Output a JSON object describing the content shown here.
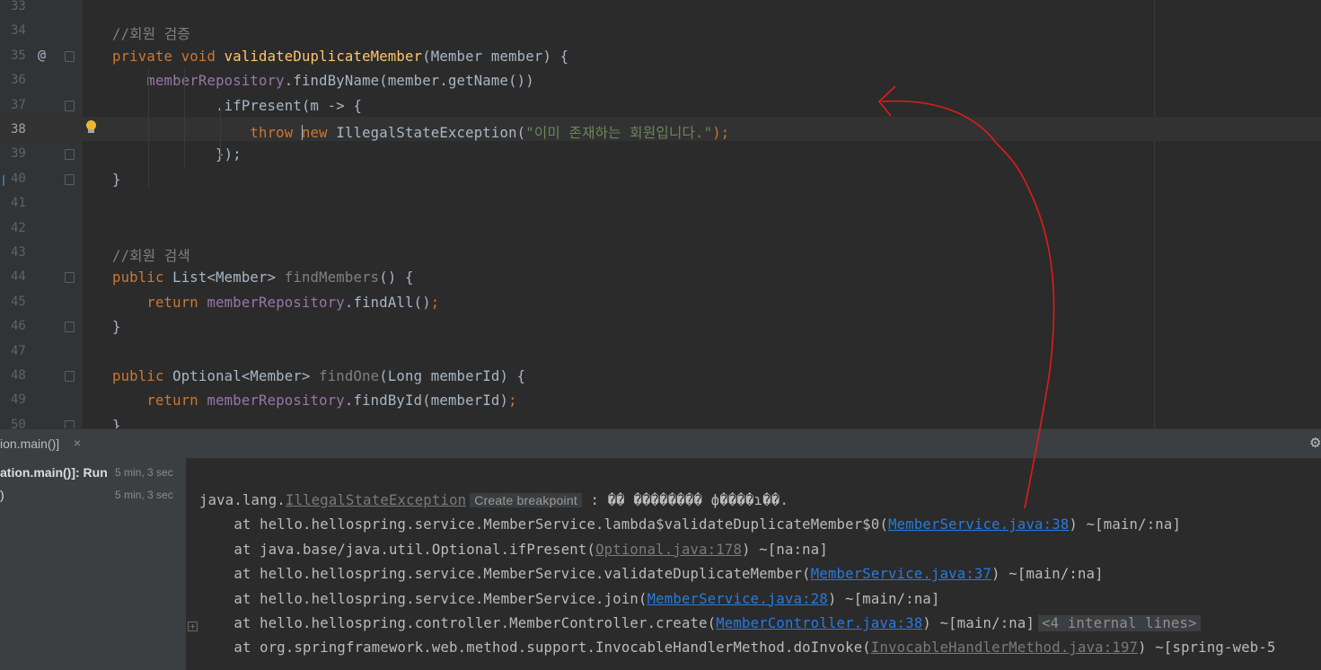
{
  "editor": {
    "lines": [
      {
        "num": "33",
        "tokens": []
      },
      {
        "num": "34",
        "tokens": [
          {
            "t": "//회원 검증",
            "c": "cm"
          }
        ]
      },
      {
        "num": "35",
        "tokens": [
          {
            "t": "private ",
            "c": "kw"
          },
          {
            "t": "void ",
            "c": "kw"
          },
          {
            "t": "validateDuplicateMember",
            "c": "fn"
          },
          {
            "t": "(Member member) {",
            "c": ""
          }
        ]
      },
      {
        "num": "36",
        "tokens": [
          {
            "t": "    ",
            "c": ""
          },
          {
            "t": "memberRepository",
            "c": "fld"
          },
          {
            "t": ".findByName(member.getName())",
            "c": ""
          }
        ]
      },
      {
        "num": "37",
        "tokens": [
          {
            "t": "            .ifPresent(m -> {",
            "c": ""
          }
        ]
      },
      {
        "num": "38",
        "tokens": [
          {
            "t": "                ",
            "c": ""
          },
          {
            "t": "throw ",
            "c": "kw"
          },
          {
            "t": "CARET",
            "c": "caret"
          },
          {
            "t": "new ",
            "c": "kw"
          },
          {
            "t": "IllegalStateException(",
            "c": ""
          },
          {
            "t": "\"이미 존재하는 회원입니다.\"",
            "c": "str"
          },
          {
            "t": ");",
            "c": "kw"
          }
        ]
      },
      {
        "num": "39",
        "tokens": [
          {
            "t": "            });",
            "c": ""
          }
        ]
      },
      {
        "num": "40",
        "tokens": [
          {
            "t": "}",
            "c": ""
          }
        ]
      },
      {
        "num": "41",
        "tokens": []
      },
      {
        "num": "42",
        "tokens": []
      },
      {
        "num": "43",
        "tokens": [
          {
            "t": "//회원 검색",
            "c": "cm"
          }
        ]
      },
      {
        "num": "44",
        "tokens": [
          {
            "t": "public ",
            "c": "kw"
          },
          {
            "t": "List<Member> ",
            "c": ""
          },
          {
            "t": "findMembers",
            "c": "gray"
          },
          {
            "t": "() {",
            "c": ""
          }
        ]
      },
      {
        "num": "45",
        "tokens": [
          {
            "t": "    ",
            "c": ""
          },
          {
            "t": "return ",
            "c": "kw"
          },
          {
            "t": "memberRepository",
            "c": "fld"
          },
          {
            "t": ".findAll()",
            "c": ""
          },
          {
            "t": ";",
            "c": "kw"
          }
        ]
      },
      {
        "num": "46",
        "tokens": [
          {
            "t": "}",
            "c": ""
          }
        ]
      },
      {
        "num": "47",
        "tokens": []
      },
      {
        "num": "48",
        "tokens": [
          {
            "t": "public ",
            "c": "kw"
          },
          {
            "t": "Optional<Member> ",
            "c": ""
          },
          {
            "t": "findOne",
            "c": "gray"
          },
          {
            "t": "(Long memberId) {",
            "c": ""
          }
        ]
      },
      {
        "num": "49",
        "tokens": [
          {
            "t": "    ",
            "c": ""
          },
          {
            "t": "return ",
            "c": "kw"
          },
          {
            "t": "memberRepository",
            "c": "fld"
          },
          {
            "t": ".findById(memberId)",
            "c": ""
          },
          {
            "t": ";",
            "c": "kw"
          }
        ]
      },
      {
        "num": "50",
        "tokens": [
          {
            "t": "}",
            "c": ""
          }
        ]
      }
    ],
    "current_line": "38",
    "annotation_mark": "@"
  },
  "run_panel": {
    "tab_label": "ion.main()]",
    "tab_close": "×",
    "tree": [
      {
        "label": "ation.main()]: Run",
        "time": "5 min, 3 sec"
      },
      {
        "label": ")",
        "time": "5 min, 3 sec"
      }
    ]
  },
  "console": {
    "lines": [
      {
        "parts": [
          {
            "t": "java.lang.",
            "c": ""
          },
          {
            "t": "IllegalStateException",
            "c": "dimlink"
          },
          {
            "t": "Create breakpoint",
            "c": "badge"
          },
          {
            "t": " : �� �������� ф����ɿ��.",
            "c": ""
          }
        ]
      },
      {
        "parts": [
          {
            "t": "    at hello.hellospring.service.MemberService.lambda$validateDuplicateMember$0(",
            "c": ""
          },
          {
            "t": "MemberService.java:38",
            "c": "link"
          },
          {
            "t": ") ~[main/:na]",
            "c": ""
          }
        ]
      },
      {
        "parts": [
          {
            "t": "    at java.base/java.util.Optional.ifPresent(",
            "c": ""
          },
          {
            "t": "Optional.java:178",
            "c": "dimlink"
          },
          {
            "t": ") ~[na:na]",
            "c": ""
          }
        ]
      },
      {
        "parts": [
          {
            "t": "    at hello.hellospring.service.MemberService.validateDuplicateMember(",
            "c": ""
          },
          {
            "t": "MemberService.java:37",
            "c": "link"
          },
          {
            "t": ") ~[main/:na]",
            "c": ""
          }
        ]
      },
      {
        "parts": [
          {
            "t": "    at hello.hellospring.service.MemberService.join(",
            "c": ""
          },
          {
            "t": "MemberService.java:28",
            "c": "link"
          },
          {
            "t": ") ~[main/:na]",
            "c": ""
          }
        ]
      },
      {
        "parts": [
          {
            "t": "    at hello.hellospring.controller.MemberController.create(",
            "c": ""
          },
          {
            "t": "MemberController.java:38",
            "c": "link"
          },
          {
            "t": ") ~[main/:na]",
            "c": ""
          },
          {
            "t": "<4 internal lines>",
            "c": "badge-mono"
          }
        ],
        "expand": true
      },
      {
        "parts": [
          {
            "t": "    at org.springframework.web.method.support.InvocableHandlerMethod.doInvoke(",
            "c": ""
          },
          {
            "t": "InvocableHandlerMethod.java:197",
            "c": "dimlink"
          },
          {
            "t": ") ~[spring-web-5",
            "c": ""
          }
        ]
      }
    ]
  },
  "colors": {
    "editor_bg": "#2b2b2b",
    "keyword": "#cc7832",
    "method": "#ffc66d",
    "field": "#9876aa",
    "string": "#6a8759",
    "link": "#287bde",
    "annotation_stroke": "#e01b1b"
  }
}
